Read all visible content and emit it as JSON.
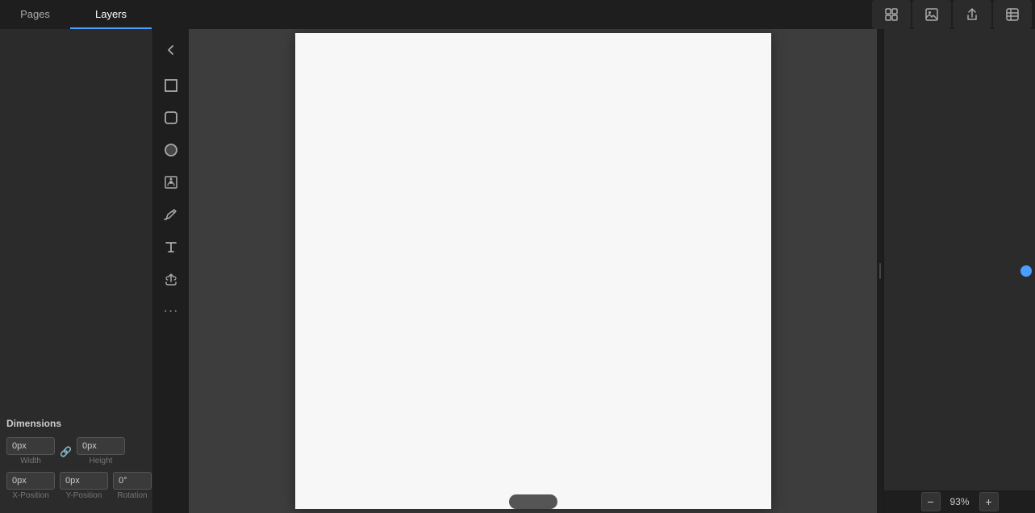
{
  "tabs": {
    "pages_label": "Pages",
    "layers_label": "Layers",
    "active": "Layers"
  },
  "toolbar": {
    "grid_icon": "grid-icon",
    "image_icon": "image-icon",
    "share_icon": "share-icon",
    "more_icon": "more-icon"
  },
  "tools": {
    "back_label": "←",
    "rectangle_label": "□",
    "rounded_rect_label": "▢",
    "circle_label": "●",
    "frame_label": "⊡",
    "pen_label": "✏",
    "text_label": "T",
    "upload_label": "↑",
    "more_label": "···"
  },
  "dimensions": {
    "label": "Dimensions",
    "width_value": "0px",
    "width_label": "Width",
    "height_value": "0px",
    "height_label": "Height",
    "x_value": "0px",
    "x_label": "X-Position",
    "y_value": "0px",
    "y_label": "Y-Position",
    "rotation_value": "0°",
    "rotation_label": "Rotation"
  },
  "zoom": {
    "minus_label": "−",
    "value": "93%",
    "plus_label": "+"
  }
}
